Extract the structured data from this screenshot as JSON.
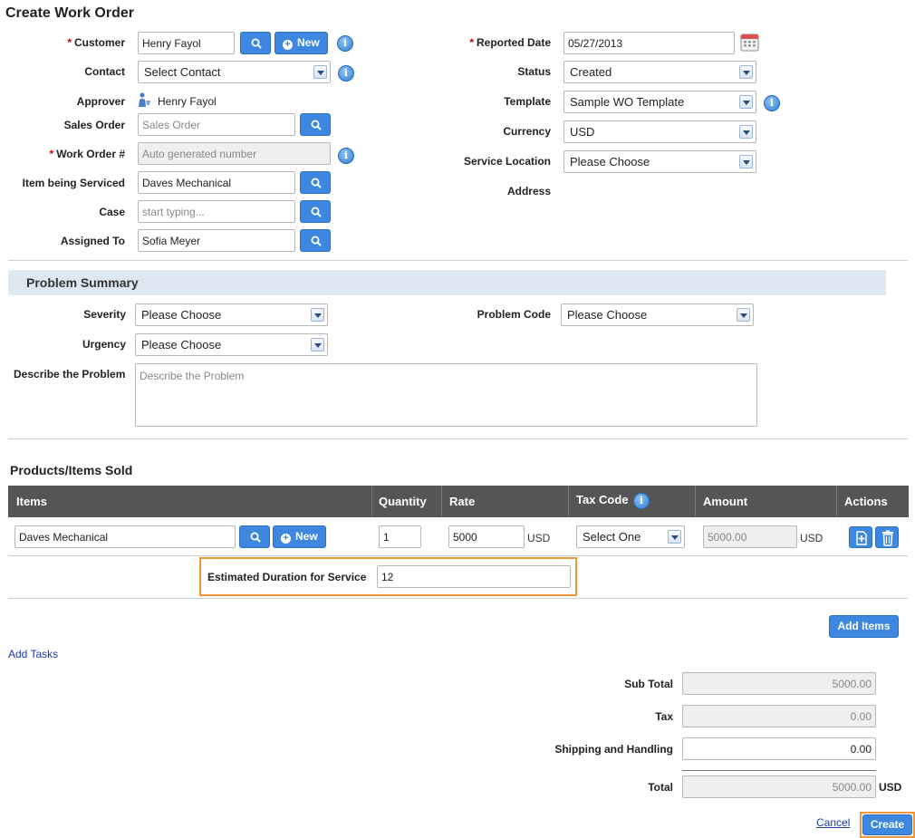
{
  "page": {
    "title": "Create Work Order"
  },
  "header_form": {
    "customer": {
      "label": "Customer",
      "value": "Henry Fayol",
      "new_label": "New"
    },
    "contact": {
      "label": "Contact",
      "value": "Select Contact"
    },
    "approver": {
      "label": "Approver",
      "value": "Henry Fayol"
    },
    "sales_order": {
      "label": "Sales Order",
      "placeholder": "Sales Order"
    },
    "work_order_no": {
      "label": "Work Order #",
      "placeholder": "Auto generated number"
    },
    "item_serviced": {
      "label": "Item being Serviced",
      "value": "Daves Mechanical"
    },
    "case": {
      "label": "Case",
      "placeholder": "start typing..."
    },
    "assigned_to": {
      "label": "Assigned To",
      "value": "Sofia Meyer"
    },
    "reported_date": {
      "label": "Reported Date",
      "value": "05/27/2013"
    },
    "status": {
      "label": "Status",
      "value": "Created"
    },
    "template": {
      "label": "Template",
      "value": "Sample WO Template"
    },
    "currency": {
      "label": "Currency",
      "value": "USD"
    },
    "service_location": {
      "label": "Service Location",
      "value": "Please Choose"
    },
    "address": {
      "label": "Address"
    }
  },
  "problem": {
    "section_title": "Problem Summary",
    "severity": {
      "label": "Severity",
      "value": "Please Choose"
    },
    "urgency": {
      "label": "Urgency",
      "value": "Please Choose"
    },
    "problem_code": {
      "label": "Problem Code",
      "value": "Please Choose"
    },
    "describe": {
      "label": "Describe the Problem",
      "placeholder": "Describe the Problem"
    }
  },
  "products": {
    "section_title": "Products/Items Sold",
    "columns": {
      "items": "Items",
      "quantity": "Quantity",
      "rate": "Rate",
      "tax_code": "Tax Code",
      "amount": "Amount",
      "actions": "Actions"
    },
    "row": {
      "item": "Daves Mechanical",
      "new_label": "New",
      "quantity": "1",
      "rate": "5000",
      "rate_currency": "USD",
      "tax_code": "Select One",
      "amount": "5000.00",
      "amount_currency": "USD"
    },
    "duration": {
      "label": "Estimated Duration for Service",
      "value": "12"
    },
    "add_items_label": "Add Items"
  },
  "tasks": {
    "add_tasks_label": "Add Tasks"
  },
  "totals": {
    "sub_total": {
      "label": "Sub Total",
      "value": "5000.00"
    },
    "tax": {
      "label": "Tax",
      "value": "0.00"
    },
    "shipping": {
      "label": "Shipping and Handling",
      "value": "0.00"
    },
    "total": {
      "label": "Total",
      "value": "5000.00",
      "currency": "USD"
    }
  },
  "footer": {
    "cancel_label": "Cancel",
    "create_label": "Create"
  },
  "colors": {
    "accent": "#3d87e0",
    "highlight": "#f0973a",
    "section_bar": "#dde8f2",
    "table_head": "#555555",
    "required": "#cc0000"
  }
}
